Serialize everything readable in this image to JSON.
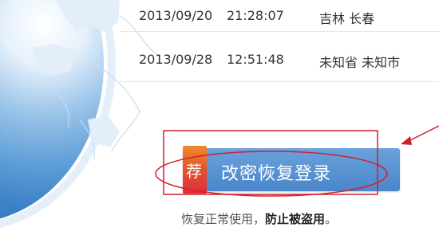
{
  "login_records": [
    {
      "date": "2013/09/20",
      "time": "21:28:07",
      "location": "吉林  长春"
    },
    {
      "date": "2013/09/28",
      "time": "12:51:48",
      "location": "未知省  未知市"
    }
  ],
  "cta": {
    "badge": "荐",
    "label": "改密恢复登录"
  },
  "footer": {
    "prefix": "恢复正常使用，",
    "emphasis": "防止被盗用",
    "suffix": "。"
  },
  "colors": {
    "button_blue": "#5b96d4",
    "badge_orange": "#f08a2a",
    "annotation_red": "#d0202a"
  }
}
